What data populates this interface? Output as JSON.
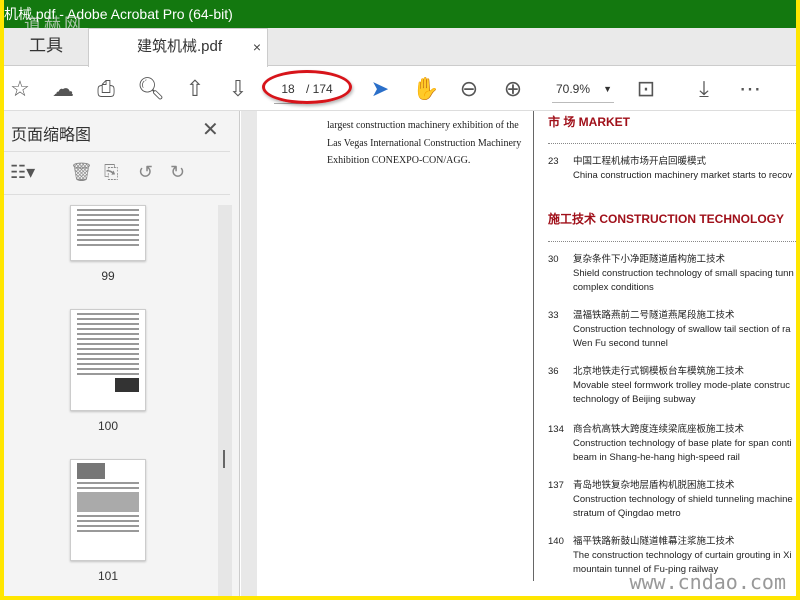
{
  "title": "机械.pdf - Adobe Acrobat Pro (64-bit)",
  "watermark_top": "道赫网",
  "watermark_bottom": "www.cndao.com",
  "tabs": {
    "tools": "工具",
    "doc": "建筑机械.pdf",
    "close": "×"
  },
  "toolbar": {
    "page_current": "18",
    "page_total": "/ 174",
    "zoom": "70.9%",
    "zoom_caret": "▼"
  },
  "sidebar": {
    "title": "页面缩略图",
    "close": "✕",
    "thumbs": [
      {
        "label": "99"
      },
      {
        "label": "100"
      },
      {
        "label": "101"
      }
    ]
  },
  "left_col": [
    "largest construction machinery exhibition of the",
    "Las Vegas International Construction Machinery",
    "Exhibition CONEXPO-CON/AGG."
  ],
  "sections": [
    {
      "heading": "市    场 MARKET",
      "items": [
        {
          "num": "23",
          "cn": "中国工程机械市场开启回暖模式",
          "en": [
            "China construction machinery market starts to recov"
          ]
        }
      ]
    },
    {
      "heading": "施工技术 CONSTRUCTION TECHNOLOGY",
      "items": [
        {
          "num": "30",
          "cn": "复杂条件下小净距隧道盾构施工技术",
          "en": [
            "Shield construction technology of small spacing tunn",
            "complex conditions"
          ]
        },
        {
          "num": "33",
          "cn": "温福铁路燕前二号隧道燕尾段施工技术",
          "en": [
            "Construction technology of swallow tail section of ra",
            "Wen Fu second tunnel"
          ]
        },
        {
          "num": "36",
          "cn": "北京地铁走行式钢模板台车模筑施工技术",
          "en": [
            "Movable steel formwork trolley mode-plate construc",
            "technology of Beijing subway"
          ]
        },
        {
          "num": "134",
          "cn": "商合杭高铁大跨度连续梁底座板施工技术",
          "en": [
            "Construction technology of base plate for span conti",
            "beam in Shang-he-hang high-speed rail"
          ]
        },
        {
          "num": "137",
          "cn": "青岛地铁复杂地层盾构机脱困施工技术",
          "en": [
            "Construction technology of shield tunneling machine",
            "stratum of Qingdao metro"
          ]
        },
        {
          "num": "140",
          "cn": "福平铁路新鼓山隧道帷幕注浆施工技术",
          "en": [
            "The construction technology of curtain grouting in Xi",
            "mountain tunnel of Fu-ping railway"
          ]
        }
      ]
    }
  ]
}
